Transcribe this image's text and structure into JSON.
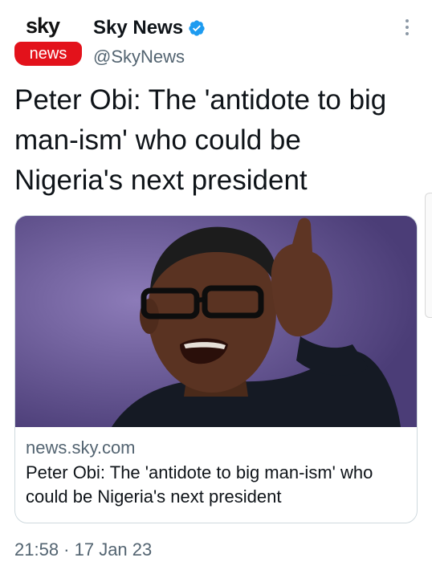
{
  "author": {
    "avatar_top": "sky",
    "avatar_bottom": "news",
    "display_name": "Sky News",
    "handle": "@SkyNews",
    "verified_color": "#1d9bf0"
  },
  "tweet": {
    "text": "Peter Obi: The 'antidote to big man-ism' who could be Nigeria's next president",
    "timestamp": "21:58 · 17 Jan 23"
  },
  "card": {
    "domain": "news.sky.com",
    "title": "Peter Obi: The 'antidote to big man-ism' who could be Nigeria's next president"
  },
  "colors": {
    "brand_red": "#e3121b",
    "secondary_text": "#536471"
  }
}
